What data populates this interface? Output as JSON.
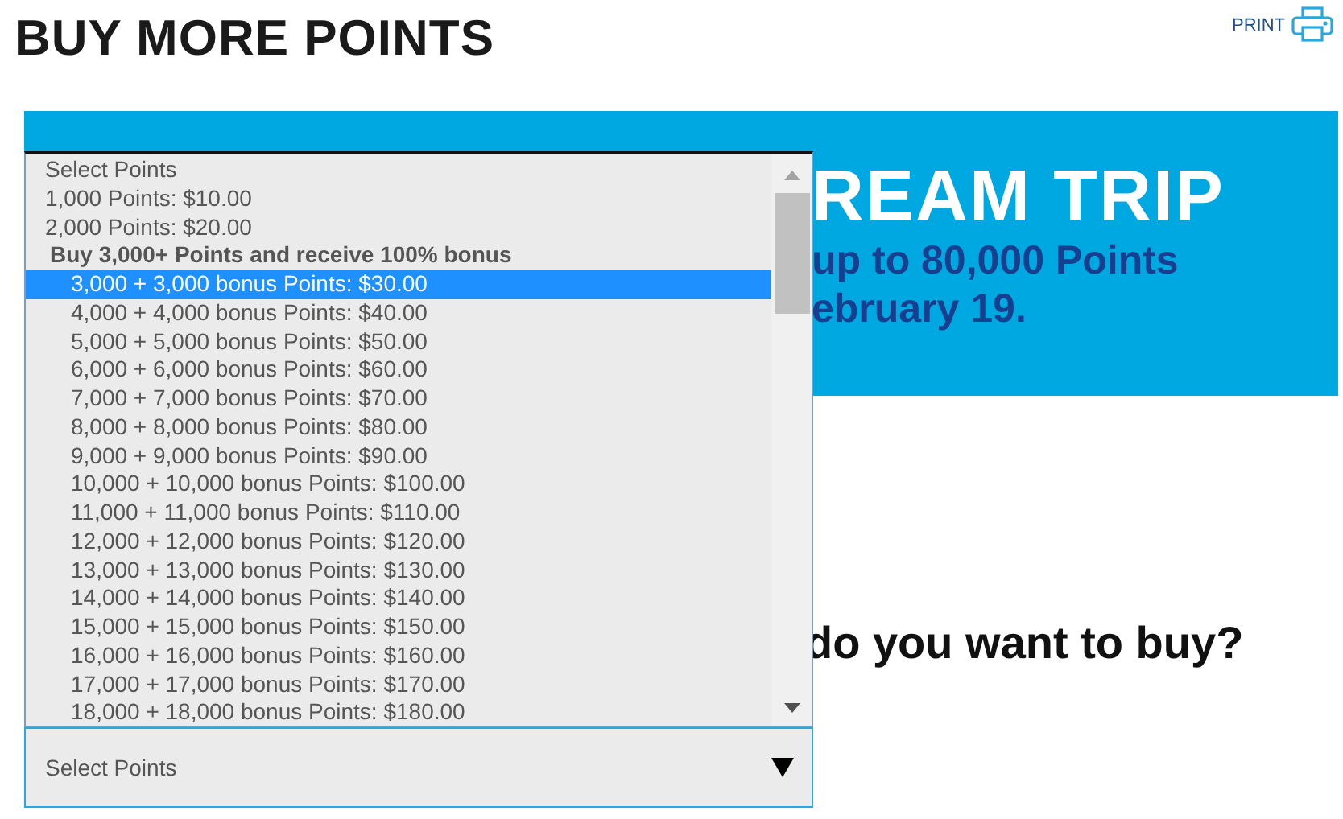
{
  "header": {
    "title": "BUY MORE POINTS",
    "print_label": "PRINT"
  },
  "banner": {
    "headline": "REAM TRIP",
    "lines": [
      "up to 80,000 Points",
      "ebruary 19."
    ]
  },
  "question": "do you want to buy?",
  "select": {
    "value": "Select Points",
    "open": true
  },
  "options": [
    {
      "kind": "option",
      "label": "Select Points",
      "selected": false
    },
    {
      "kind": "option",
      "label": "1,000 Points: $10.00",
      "selected": false
    },
    {
      "kind": "option",
      "label": "2,000 Points: $20.00",
      "selected": false
    },
    {
      "kind": "group",
      "label": "Buy 3,000+ Points and receive 100% bonus",
      "children": [
        {
          "label": "3,000 + 3,000 bonus Points: $30.00",
          "selected": true
        },
        {
          "label": "4,000 + 4,000 bonus Points: $40.00",
          "selected": false
        },
        {
          "label": "5,000 + 5,000 bonus Points: $50.00",
          "selected": false
        },
        {
          "label": "6,000 + 6,000 bonus Points: $60.00",
          "selected": false
        },
        {
          "label": "7,000 + 7,000 bonus Points: $70.00",
          "selected": false
        },
        {
          "label": "8,000 + 8,000 bonus Points: $80.00",
          "selected": false
        },
        {
          "label": "9,000 + 9,000 bonus Points: $90.00",
          "selected": false
        },
        {
          "label": "10,000 + 10,000 bonus Points: $100.00",
          "selected": false
        },
        {
          "label": "11,000 + 11,000 bonus Points: $110.00",
          "selected": false
        },
        {
          "label": "12,000 + 12,000 bonus Points: $120.00",
          "selected": false
        },
        {
          "label": "13,000 + 13,000 bonus Points: $130.00",
          "selected": false
        },
        {
          "label": "14,000 + 14,000 bonus Points: $140.00",
          "selected": false
        },
        {
          "label": "15,000 + 15,000 bonus Points: $150.00",
          "selected": false
        },
        {
          "label": "16,000 + 16,000 bonus Points: $160.00",
          "selected": false
        },
        {
          "label": "17,000 + 17,000 bonus Points: $170.00",
          "selected": false
        },
        {
          "label": "18,000 + 18,000 bonus Points: $180.00",
          "selected": false
        }
      ]
    }
  ]
}
